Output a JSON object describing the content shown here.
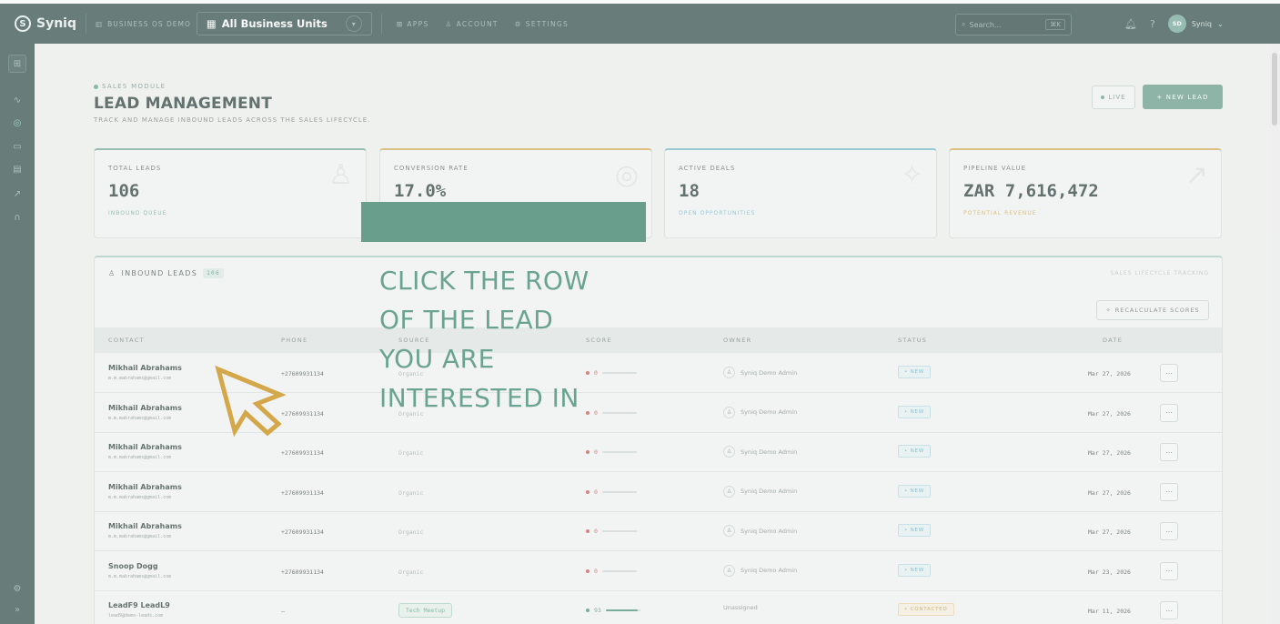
{
  "topbar": {
    "brand": "Syniq",
    "workspace": "BUSINESS OS DEMO",
    "units": "All Business Units",
    "nav": [
      "APPS",
      "ACCOUNT",
      "SETTINGS"
    ],
    "search_placeholder": "Search...",
    "search_kbd": "⌘K",
    "avatar_initials": "SD",
    "user": "Syniq"
  },
  "header": {
    "module": "SALES MODULE",
    "title": "LEAD MANAGEMENT",
    "subtitle": "TRACK AND MANAGE INBOUND LEADS ACROSS THE SALES LIFECYCLE.",
    "live": "LIVE",
    "new_lead": "+ NEW LEAD"
  },
  "stats": [
    {
      "label": "TOTAL LEADS",
      "value": "106",
      "sub": "INBOUND QUEUE",
      "color": "#6aa394"
    },
    {
      "label": "CONVERSION RATE",
      "value": "17.0%",
      "sub": "",
      "color": "#d4a84a"
    },
    {
      "label": "ACTIVE DEALS",
      "value": "18",
      "sub": "OPEN OPPORTUNITIES",
      "color": "#6ab4c8"
    },
    {
      "label": "PIPELINE VALUE",
      "value": "ZAR 7,616,472",
      "sub": "POTENTIAL REVENUE",
      "color": "#d4a84a"
    }
  ],
  "panel": {
    "title": "INBOUND LEADS",
    "count": "106",
    "tag": "SALES LIFECYCLE TRACKING",
    "recalc": "RECALCULATE SCORES",
    "columns": [
      "CONTACT",
      "PHONE",
      "SOURCE",
      "SCORE",
      "OWNER",
      "STATUS",
      "DATE"
    ]
  },
  "rows": [
    {
      "name": "Mikhail Abrahams",
      "email": "m.m.mabrahams@gmail.com",
      "phone": "+27609931134",
      "source": "Organic",
      "score": "0",
      "score_pct": 0,
      "owner": "Syniq Demo Admin",
      "status": "• NEW",
      "date": "Mar 27, 2026"
    },
    {
      "name": "Mikhail Abrahams",
      "email": "m.m.mabrahams@gmail.com",
      "phone": "+27609931134",
      "source": "Organic",
      "score": "0",
      "score_pct": 0,
      "owner": "Syniq Demo Admin",
      "status": "• NEW",
      "date": "Mar 27, 2026"
    },
    {
      "name": "Mikhail Abrahams",
      "email": "m.m.mabrahams@gmail.com",
      "phone": "+27609931134",
      "source": "Organic",
      "score": "0",
      "score_pct": 0,
      "owner": "Syniq Demo Admin",
      "status": "• NEW",
      "date": "Mar 27, 2026"
    },
    {
      "name": "Mikhail Abrahams",
      "email": "m.m.mabrahams@gmail.com",
      "phone": "+27609931134",
      "source": "Organic",
      "score": "0",
      "score_pct": 0,
      "owner": "Syniq Demo Admin",
      "status": "• NEW",
      "date": "Mar 27, 2026"
    },
    {
      "name": "Mikhail Abrahams",
      "email": "m.m.mabrahams@gmail.com",
      "phone": "+27609931134",
      "source": "Organic",
      "score": "0",
      "score_pct": 0,
      "owner": "Syniq Demo Admin",
      "status": "• NEW",
      "date": "Mar 27, 2026"
    },
    {
      "name": "Snoop Dogg",
      "email": "m.m.mabrahams@gmail.com",
      "phone": "+27609931134",
      "source": "Organic",
      "score": "0",
      "score_pct": 0,
      "owner": "Syniq Demo Admin",
      "status": "• NEW",
      "date": "Mar 23, 2026"
    },
    {
      "name": "LeadF9 LeadL9",
      "email": "lead9@demo-leads.com",
      "phone": "–",
      "source": "Tech Meetup",
      "score": "93",
      "score_pct": 93,
      "owner": "Unassigned",
      "status": "• CONTACTED",
      "date": "Mar 11, 2026"
    }
  ],
  "overlay": {
    "lines": [
      "CLICK THE ROW",
      "OF THE LEAD",
      "YOU ARE",
      "INTERESTED IN"
    ],
    "color": "#6aa391",
    "cursor_color": "#d4a84a"
  }
}
